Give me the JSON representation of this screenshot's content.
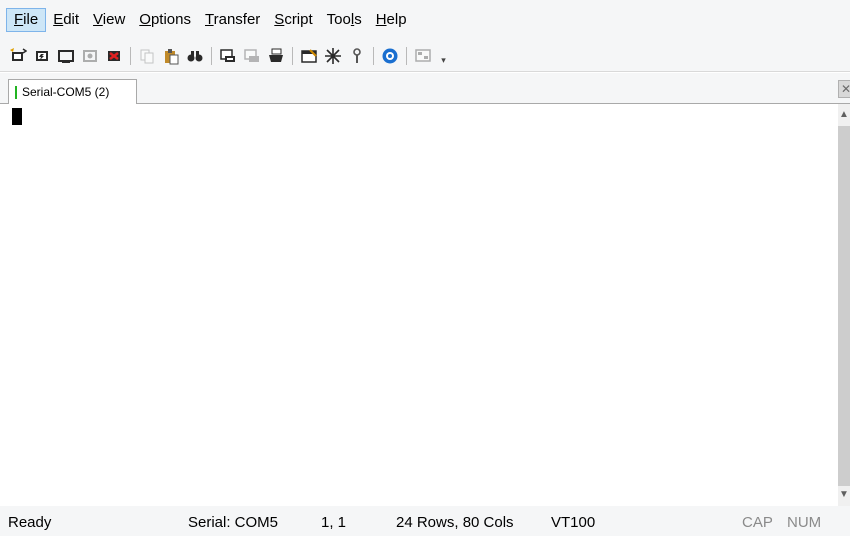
{
  "menu": {
    "items": [
      {
        "mn": "F",
        "rest": "ile"
      },
      {
        "mn": "E",
        "rest": "dit"
      },
      {
        "mn": "V",
        "rest": "iew"
      },
      {
        "mn": "O",
        "rest": "ptions"
      },
      {
        "mn": "T",
        "rest": "ransfer"
      },
      {
        "mn": "S",
        "rest": "cript"
      },
      {
        "pre": "Too",
        "mn": "l",
        "rest": "s"
      },
      {
        "mn": "H",
        "rest": "elp"
      }
    ]
  },
  "toolbar": {
    "icons": [
      "connect-icon",
      "quick-connect-icon",
      "connect-tab-icon",
      "reconnect-icon",
      "disconnect-icon",
      "copy-icon",
      "paste-icon",
      "find-icon",
      "print-setup-icon",
      "print-selection-icon",
      "print-icon",
      "session-options-icon",
      "keymap-icon",
      "key-agent-icon",
      "help-icon",
      "screen-icon"
    ],
    "overflow": "▾"
  },
  "tab": {
    "label": "Serial-COM5 (2)",
    "close_glyph": "✕"
  },
  "scrollbar": {
    "up": "▲",
    "down": "▼"
  },
  "status": {
    "ready": "Ready",
    "connection": "Serial: COM5",
    "position": "1,  1",
    "size": "24 Rows,  80 Cols",
    "terminal_type": "VT100",
    "cap": "CAP",
    "num": "NUM"
  }
}
